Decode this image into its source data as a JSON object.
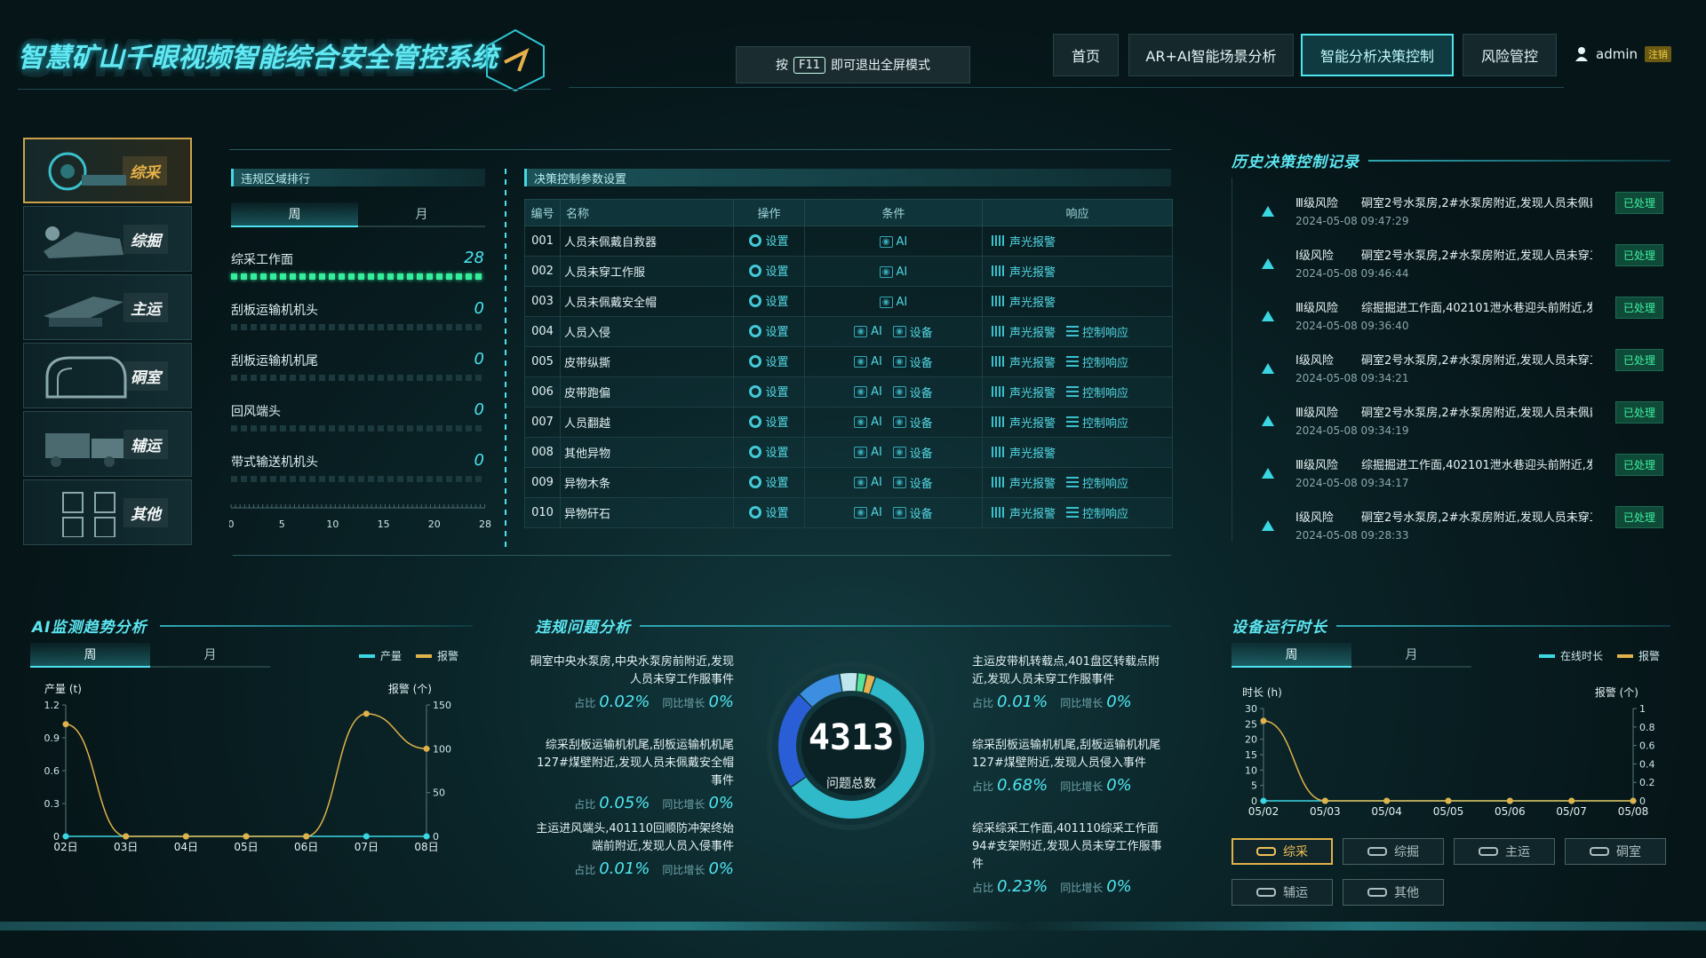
{
  "header": {
    "watermark": "SMART MINE",
    "title": "智慧矿山千眼视频智能综合安全管控系统",
    "fullscreen_pre": "按",
    "fullscreen_key": "F11",
    "fullscreen_post": "即可退出全屏模式"
  },
  "nav": [
    "首页",
    "AR+AI智能场景分析",
    "智能分析决策控制",
    "风险管控"
  ],
  "nav_active": 2,
  "user": {
    "name": "admin",
    "logout": "注销"
  },
  "sidebar": [
    {
      "label": "综采"
    },
    {
      "label": "综掘"
    },
    {
      "label": "主运"
    },
    {
      "label": "硐室"
    },
    {
      "label": "辅运"
    },
    {
      "label": "其他"
    }
  ],
  "ranking": {
    "title": "违规区域排行",
    "tabs": [
      "周",
      "月"
    ],
    "items": [
      {
        "name": "综采工作面",
        "value": 28
      },
      {
        "name": "刮板运输机机头",
        "value": 0
      },
      {
        "name": "刮板运输机机尾",
        "value": 0
      },
      {
        "name": "回风端头",
        "value": 0
      },
      {
        "name": "带式输送机机头",
        "value": 0
      }
    ],
    "axis": [
      "0",
      "5",
      "10",
      "15",
      "20",
      "28"
    ],
    "max": 28
  },
  "decision": {
    "title": "决策控制参数设置",
    "headers": [
      "编号",
      "名称",
      "操作",
      "条件",
      "响应"
    ],
    "rows": [
      {
        "id": "001",
        "name": "人员未佩戴自救器",
        "op": "设置",
        "ai": "AI",
        "dev": "",
        "snd": "声光报警",
        "ctl": ""
      },
      {
        "id": "002",
        "name": "人员未穿工作服",
        "op": "设置",
        "ai": "AI",
        "dev": "",
        "snd": "声光报警",
        "ctl": ""
      },
      {
        "id": "003",
        "name": "人员未佩戴安全帽",
        "op": "设置",
        "ai": "AI",
        "dev": "",
        "snd": "声光报警",
        "ctl": ""
      },
      {
        "id": "004",
        "name": "人员入侵",
        "op": "设置",
        "ai": "AI",
        "dev": "设备",
        "snd": "声光报警",
        "ctl": "控制响应"
      },
      {
        "id": "005",
        "name": "皮带纵撕",
        "op": "设置",
        "ai": "AI",
        "dev": "设备",
        "snd": "声光报警",
        "ctl": "控制响应"
      },
      {
        "id": "006",
        "name": "皮带跑偏",
        "op": "设置",
        "ai": "AI",
        "dev": "设备",
        "snd": "声光报警",
        "ctl": "控制响应"
      },
      {
        "id": "007",
        "name": "人员翻越",
        "op": "设置",
        "ai": "AI",
        "dev": "设备",
        "snd": "声光报警",
        "ctl": "控制响应"
      },
      {
        "id": "008",
        "name": "其他异物",
        "op": "设置",
        "ai": "AI",
        "dev": "设备",
        "snd": "声光报警",
        "ctl": ""
      },
      {
        "id": "009",
        "name": "异物木条",
        "op": "设置",
        "ai": "AI",
        "dev": "设备",
        "snd": "声光报警",
        "ctl": "控制响应"
      },
      {
        "id": "010",
        "name": "异物矸石",
        "op": "设置",
        "ai": "AI",
        "dev": "设备",
        "snd": "声光报警",
        "ctl": "控制响应"
      }
    ]
  },
  "history": {
    "title": "历史决策控制记录",
    "items": [
      {
        "level": "Ⅲ级风险",
        "desc": "硐室2号水泵房,2#水泵房附近,发现人员未佩戴",
        "time": "2024-05-08 09:47:29",
        "status": "已处理"
      },
      {
        "level": "Ⅰ级风险",
        "desc": "硐室2号水泵房,2#水泵房附近,发现人员未穿工",
        "time": "2024-05-08 09:46:44",
        "status": "已处理"
      },
      {
        "level": "Ⅲ级风险",
        "desc": "综掘掘进工作面,402101泄水巷迎头前附近,发现",
        "time": "2024-05-08 09:36:40",
        "status": "已处理"
      },
      {
        "level": "Ⅰ级风险",
        "desc": "硐室2号水泵房,2#水泵房附近,发现人员未穿工",
        "time": "2024-05-08 09:34:21",
        "status": "已处理"
      },
      {
        "level": "Ⅲ级风险",
        "desc": "硐室2号水泵房,2#水泵房附近,发现人员未佩戴",
        "time": "2024-05-08 09:34:19",
        "status": "已处理"
      },
      {
        "level": "Ⅲ级风险",
        "desc": "综掘掘进工作面,402101泄水巷迎头前附近,发现",
        "time": "2024-05-08 09:34:17",
        "status": "已处理"
      },
      {
        "level": "Ⅰ级风险",
        "desc": "硐室2号水泵房,2#水泵房附近,发现人员未穿工",
        "time": "2024-05-08 09:28:33",
        "status": "已处理"
      }
    ]
  },
  "ai_trend": {
    "title": "AI监测趋势分析",
    "tabs": [
      "周",
      "月"
    ],
    "legend": [
      "产量",
      "报警"
    ],
    "ylabel_left": "产量 (t)",
    "ylabel_right": "报警 (个)"
  },
  "violation": {
    "title": "违规问题分析",
    "total": "4313",
    "total_label": "问题总数",
    "share_label": "占比",
    "growth_label": "同比增长",
    "left": [
      {
        "desc": "硐室中央水泵房,中央水泵房前附近,发现人员未穿工作服事件",
        "share": "0.02%",
        "growth": "0%"
      },
      {
        "desc": "综采刮板运输机机尾,刮板运输机机尾127#煤壁附近,发现人员未佩戴安全帽事件",
        "share": "0.05%",
        "growth": "0%"
      },
      {
        "desc": "主运进风端头,401110回顺防冲架终始端前附近,发现人员入侵事件",
        "share": "0.01%",
        "growth": "0%"
      }
    ],
    "right": [
      {
        "desc": "主运皮带机转载点,401盘区转载点附近,发现人员未穿工作服事件",
        "share": "0.01%",
        "growth": "0%"
      },
      {
        "desc": "综采刮板运输机机尾,刮板运输机机尾127#煤壁附近,发现人员侵入事件",
        "share": "0.68%",
        "growth": "0%"
      },
      {
        "desc": "综采综采工作面,401110综采工作面94#支架附近,发现人员未穿工作服事件",
        "share": "0.23%",
        "growth": "0%"
      }
    ]
  },
  "equipment": {
    "title": "设备运行时长",
    "tabs": [
      "周",
      "月"
    ],
    "legend": [
      "在线时长",
      "报警"
    ],
    "ylabel_left": "时长 (h)",
    "ylabel_right": "报警 (个)",
    "buttons": [
      "综采",
      "综掘",
      "主运",
      "硐室",
      "辅运",
      "其他"
    ]
  },
  "chart_data": [
    {
      "type": "line",
      "title": "AI监测趋势分析",
      "x": [
        "02日",
        "03日",
        "04日",
        "05日",
        "06日",
        "07日",
        "08日"
      ],
      "ylabel": "产量 (t)",
      "y2label": "报警 (个)",
      "ylim": [
        0,
        1.2
      ],
      "y2lim": [
        0,
        150
      ],
      "yticks": [
        "0",
        "0.3",
        "0.6",
        "0.9",
        "1.2"
      ],
      "y2ticks": [
        "0",
        "50",
        "100",
        "150"
      ],
      "series": [
        {
          "name": "产量",
          "axis": "left",
          "values": [
            0,
            0,
            0,
            0,
            0,
            0,
            0
          ]
        },
        {
          "name": "报警",
          "axis": "right",
          "values": [
            128,
            0,
            0,
            0,
            0,
            140,
            100
          ]
        }
      ]
    },
    {
      "type": "pie",
      "title": "违规问题分析",
      "total": 4313,
      "segments": [
        {
          "value": 0.6,
          "color": "#2fb9c9"
        },
        {
          "value": 0.22,
          "color": "#2a5ed6"
        },
        {
          "value": 0.1,
          "color": "#3b8ee0"
        },
        {
          "value": 0.04,
          "color": "#bfe6ec"
        },
        {
          "value": 0.02,
          "color": "#55e39a"
        },
        {
          "value": 0.02,
          "color": "#e7b24b"
        }
      ]
    },
    {
      "type": "line",
      "title": "设备运行时长",
      "x": [
        "05/02",
        "05/03",
        "05/04",
        "05/05",
        "05/06",
        "05/07",
        "05/08"
      ],
      "ylabel": "时长 (h)",
      "y2label": "报警 (个)",
      "ylim": [
        0,
        30
      ],
      "y2lim": [
        0,
        1
      ],
      "yticks": [
        "0",
        "5",
        "10",
        "15",
        "20",
        "25",
        "30"
      ],
      "y2ticks": [
        "0",
        "0.2",
        "0.4",
        "0.6",
        "0.8",
        "1"
      ],
      "series": [
        {
          "name": "在线时长",
          "axis": "left",
          "values": [
            0,
            0,
            0,
            0,
            0,
            0,
            0
          ]
        },
        {
          "name": "报警",
          "axis": "left",
          "values": [
            26,
            0,
            0,
            0,
            0,
            0,
            0
          ]
        }
      ]
    }
  ],
  "colors": {
    "accent": "#4ee4ef",
    "warn": "#e0b24a",
    "ok": "#34ee9c"
  }
}
